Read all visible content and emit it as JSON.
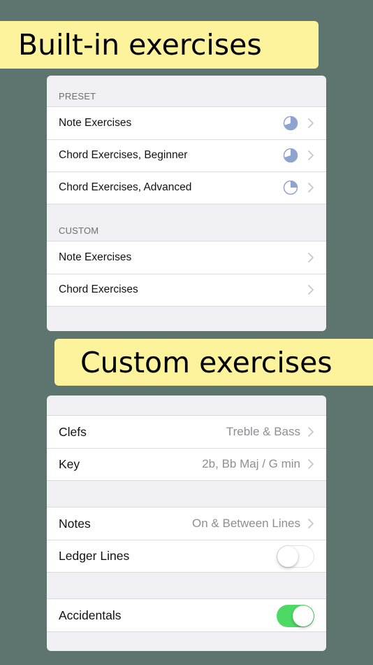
{
  "banners": {
    "built_in": "Built-in exercises",
    "custom": "Custom exercises"
  },
  "exercises_list": {
    "preset_header": "PRESET",
    "preset_items": [
      {
        "label": "Note Exercises",
        "progress": 0.7
      },
      {
        "label": "Chord Exercises, Beginner",
        "progress": 0.7
      },
      {
        "label": "Chord Exercises, Advanced",
        "progress": 0.25
      }
    ],
    "custom_header": "CUSTOM",
    "custom_items": [
      {
        "label": "Note Exercises"
      },
      {
        "label": "Chord Exercises"
      }
    ]
  },
  "custom_settings": {
    "clefs": {
      "label": "Clefs",
      "value": "Treble & Bass"
    },
    "key": {
      "label": "Key",
      "value": "2b, Bb Maj / G min"
    },
    "notes": {
      "label": "Notes",
      "value": "On & Between Lines"
    },
    "ledger_lines": {
      "label": "Ledger Lines",
      "enabled": false
    },
    "accidentals": {
      "label": "Accidentals",
      "enabled": true
    }
  },
  "colors": {
    "background": "#5d756e",
    "banner": "#fcf39c",
    "pie_fill": "#8ea4cf",
    "toggle_on": "#4cd964",
    "chevron": "#c7c7cc"
  }
}
